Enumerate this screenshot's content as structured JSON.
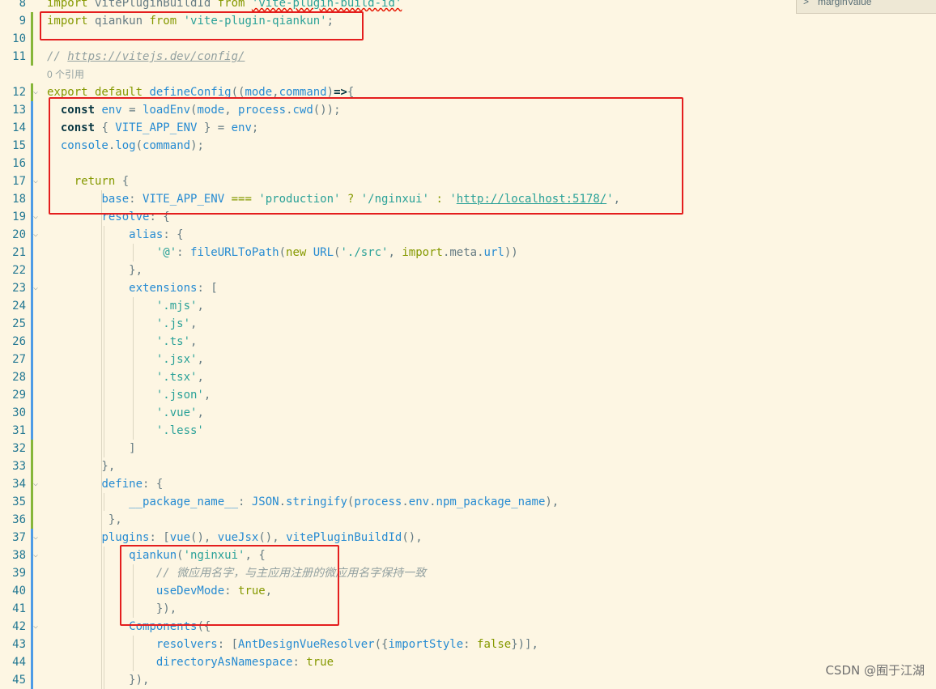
{
  "editor": {
    "lens_text": "0 个引用",
    "lines": [
      {
        "n": "8",
        "tokens": [
          [
            "kw",
            "import "
          ],
          [
            "",
            "vitePluginBuildId "
          ],
          [
            "kw",
            "from "
          ],
          [
            "str squig",
            "'vite-plugin-build-id'"
          ]
        ]
      },
      {
        "n": "9",
        "tokens": [
          [
            "kw",
            "import "
          ],
          [
            "",
            "qiankun "
          ],
          [
            "kw",
            "from "
          ],
          [
            "str",
            "'vite-plugin-qiankun'"
          ],
          [
            "",
            ";"
          ]
        ]
      },
      {
        "n": "10",
        "tokens": []
      },
      {
        "n": "11",
        "tokens": [
          [
            "cm",
            "// "
          ],
          [
            "cm link",
            "https://vitejs.dev/config/"
          ]
        ]
      },
      {
        "n": "12",
        "tokens": [
          [
            "kw",
            "export default "
          ],
          [
            "fn",
            "defineConfig"
          ],
          [
            "",
            "(("
          ],
          [
            "var",
            "mode"
          ],
          [
            "",
            ","
          ],
          [
            "var",
            "command"
          ],
          [
            "",
            ")"
          ],
          [
            "bold",
            "=>"
          ],
          [
            "",
            "{"
          ]
        ]
      },
      {
        "n": "13",
        "tokens": [
          [
            "",
            "  "
          ],
          [
            "bold",
            "const "
          ],
          [
            "var",
            "env "
          ],
          [
            "",
            "= "
          ],
          [
            "fn",
            "loadEnv"
          ],
          [
            "",
            "("
          ],
          [
            "var",
            "mode"
          ],
          [
            "",
            ", "
          ],
          [
            "var",
            "process"
          ],
          [
            "",
            "."
          ],
          [
            "fn",
            "cwd"
          ],
          [
            "",
            "());"
          ]
        ]
      },
      {
        "n": "14",
        "tokens": [
          [
            "",
            "  "
          ],
          [
            "bold",
            "const "
          ],
          [
            "",
            "{ "
          ],
          [
            "var",
            "VITE_APP_ENV "
          ],
          [
            "",
            "} = "
          ],
          [
            "var",
            "env"
          ],
          [
            "",
            ";"
          ]
        ]
      },
      {
        "n": "15",
        "tokens": [
          [
            "",
            "  "
          ],
          [
            "var",
            "console"
          ],
          [
            "",
            "."
          ],
          [
            "fn",
            "log"
          ],
          [
            "",
            "("
          ],
          [
            "var",
            "command"
          ],
          [
            "",
            ");"
          ]
        ]
      },
      {
        "n": "16",
        "tokens": []
      },
      {
        "n": "17",
        "tokens": [
          [
            "",
            "    "
          ],
          [
            "kw",
            "return "
          ],
          [
            "",
            "{"
          ]
        ]
      },
      {
        "n": "18",
        "tokens": [
          [
            "",
            "        "
          ],
          [
            "prop",
            "base"
          ],
          [
            "",
            ": "
          ],
          [
            "var",
            "VITE_APP_ENV "
          ],
          [
            "kw",
            "=== "
          ],
          [
            "str",
            "'production' "
          ],
          [
            "kw",
            "? "
          ],
          [
            "str",
            "'/nginxui' "
          ],
          [
            "kw",
            ": "
          ],
          [
            "str",
            "'"
          ],
          [
            "str link",
            "http://localhost:5178/"
          ],
          [
            "str",
            "'"
          ],
          [
            "",
            ","
          ]
        ]
      },
      {
        "n": "19",
        "tokens": [
          [
            "",
            "        "
          ],
          [
            "prop",
            "resolve"
          ],
          [
            "",
            ": {"
          ]
        ]
      },
      {
        "n": "20",
        "tokens": [
          [
            "",
            "            "
          ],
          [
            "prop",
            "alias"
          ],
          [
            "",
            ": {"
          ]
        ]
      },
      {
        "n": "21",
        "tokens": [
          [
            "",
            "                "
          ],
          [
            "str",
            "'@'"
          ],
          [
            "",
            ": "
          ],
          [
            "fn",
            "fileURLToPath"
          ],
          [
            "",
            "("
          ],
          [
            "kw",
            "new "
          ],
          [
            "fn",
            "URL"
          ],
          [
            "",
            "("
          ],
          [
            "str",
            "'./src'"
          ],
          [
            "",
            ", "
          ],
          [
            "kw",
            "import"
          ],
          [
            "",
            ".meta."
          ],
          [
            "prop",
            "url"
          ],
          [
            "",
            "))"
          ]
        ]
      },
      {
        "n": "22",
        "tokens": [
          [
            "",
            "            },"
          ]
        ]
      },
      {
        "n": "23",
        "tokens": [
          [
            "",
            "            "
          ],
          [
            "prop",
            "extensions"
          ],
          [
            "",
            ": ["
          ]
        ]
      },
      {
        "n": "24",
        "tokens": [
          [
            "",
            "                "
          ],
          [
            "str",
            "'.mjs'"
          ],
          [
            "",
            ","
          ]
        ]
      },
      {
        "n": "25",
        "tokens": [
          [
            "",
            "                "
          ],
          [
            "str",
            "'.js'"
          ],
          [
            "",
            ","
          ]
        ]
      },
      {
        "n": "26",
        "tokens": [
          [
            "",
            "                "
          ],
          [
            "str",
            "'.ts'"
          ],
          [
            "",
            ","
          ]
        ]
      },
      {
        "n": "27",
        "tokens": [
          [
            "",
            "                "
          ],
          [
            "str",
            "'.jsx'"
          ],
          [
            "",
            ","
          ]
        ]
      },
      {
        "n": "28",
        "tokens": [
          [
            "",
            "                "
          ],
          [
            "str",
            "'.tsx'"
          ],
          [
            "",
            ","
          ]
        ]
      },
      {
        "n": "29",
        "tokens": [
          [
            "",
            "                "
          ],
          [
            "str",
            "'.json'"
          ],
          [
            "",
            ","
          ]
        ]
      },
      {
        "n": "30",
        "tokens": [
          [
            "",
            "                "
          ],
          [
            "str",
            "'.vue'"
          ],
          [
            "",
            ","
          ]
        ]
      },
      {
        "n": "31",
        "tokens": [
          [
            "",
            "                "
          ],
          [
            "str",
            "'.less'"
          ]
        ]
      },
      {
        "n": "32",
        "tokens": [
          [
            "",
            "            ]"
          ]
        ]
      },
      {
        "n": "33",
        "tokens": [
          [
            "",
            "        },"
          ]
        ]
      },
      {
        "n": "34",
        "tokens": [
          [
            "",
            "        "
          ],
          [
            "prop",
            "define"
          ],
          [
            "",
            ": {"
          ]
        ]
      },
      {
        "n": "35",
        "tokens": [
          [
            "",
            "            "
          ],
          [
            "prop",
            "__package_name__"
          ],
          [
            "",
            ": "
          ],
          [
            "var",
            "JSON"
          ],
          [
            "",
            "."
          ],
          [
            "fn",
            "stringify"
          ],
          [
            "",
            "("
          ],
          [
            "var",
            "process"
          ],
          [
            "",
            "."
          ],
          [
            "var",
            "env"
          ],
          [
            "",
            "."
          ],
          [
            "var",
            "npm_package_name"
          ],
          [
            "",
            "),"
          ]
        ]
      },
      {
        "n": "36",
        "tokens": [
          [
            "",
            "         },"
          ]
        ]
      },
      {
        "n": "37",
        "tokens": [
          [
            "",
            "        "
          ],
          [
            "prop",
            "plugins"
          ],
          [
            "",
            ": ["
          ],
          [
            "fn",
            "vue"
          ],
          [
            "",
            "(), "
          ],
          [
            "fn",
            "vueJsx"
          ],
          [
            "",
            "(), "
          ],
          [
            "fn",
            "vitePluginBuildId"
          ],
          [
            "",
            "(),"
          ]
        ]
      },
      {
        "n": "38",
        "tokens": [
          [
            "",
            "            "
          ],
          [
            "fn",
            "qiankun"
          ],
          [
            "",
            "("
          ],
          [
            "str",
            "'nginxui'"
          ],
          [
            "",
            ", {"
          ]
        ]
      },
      {
        "n": "39",
        "tokens": [
          [
            "",
            "                "
          ],
          [
            "cm",
            "// 微应用名字，与主应用注册的微应用名字保持一致"
          ]
        ]
      },
      {
        "n": "40",
        "tokens": [
          [
            "",
            "                "
          ],
          [
            "prop",
            "useDevMode"
          ],
          [
            "",
            ": "
          ],
          [
            "kw",
            "true"
          ],
          [
            "",
            ","
          ]
        ]
      },
      {
        "n": "41",
        "tokens": [
          [
            "",
            "                }),"
          ]
        ]
      },
      {
        "n": "42",
        "tokens": [
          [
            "",
            "            "
          ],
          [
            "fn",
            "Components"
          ],
          [
            "",
            "({"
          ]
        ]
      },
      {
        "n": "43",
        "tokens": [
          [
            "",
            "                "
          ],
          [
            "prop",
            "resolvers"
          ],
          [
            "",
            ": ["
          ],
          [
            "fn",
            "AntDesignVueResolver"
          ],
          [
            "",
            "({"
          ],
          [
            "prop",
            "importStyle"
          ],
          [
            "",
            ": "
          ],
          [
            "kw",
            "false"
          ],
          [
            "",
            "})],"
          ]
        ]
      },
      {
        "n": "44",
        "tokens": [
          [
            "",
            "                "
          ],
          [
            "prop",
            "directoryAsNamespace"
          ],
          [
            "",
            ": "
          ],
          [
            "kw",
            "true"
          ]
        ]
      },
      {
        "n": "45",
        "tokens": [
          [
            "",
            "            }),"
          ]
        ]
      }
    ]
  },
  "widget": {
    "chevron": ">",
    "label": "marginValue"
  },
  "watermark": "CSDN @囿于江湖"
}
